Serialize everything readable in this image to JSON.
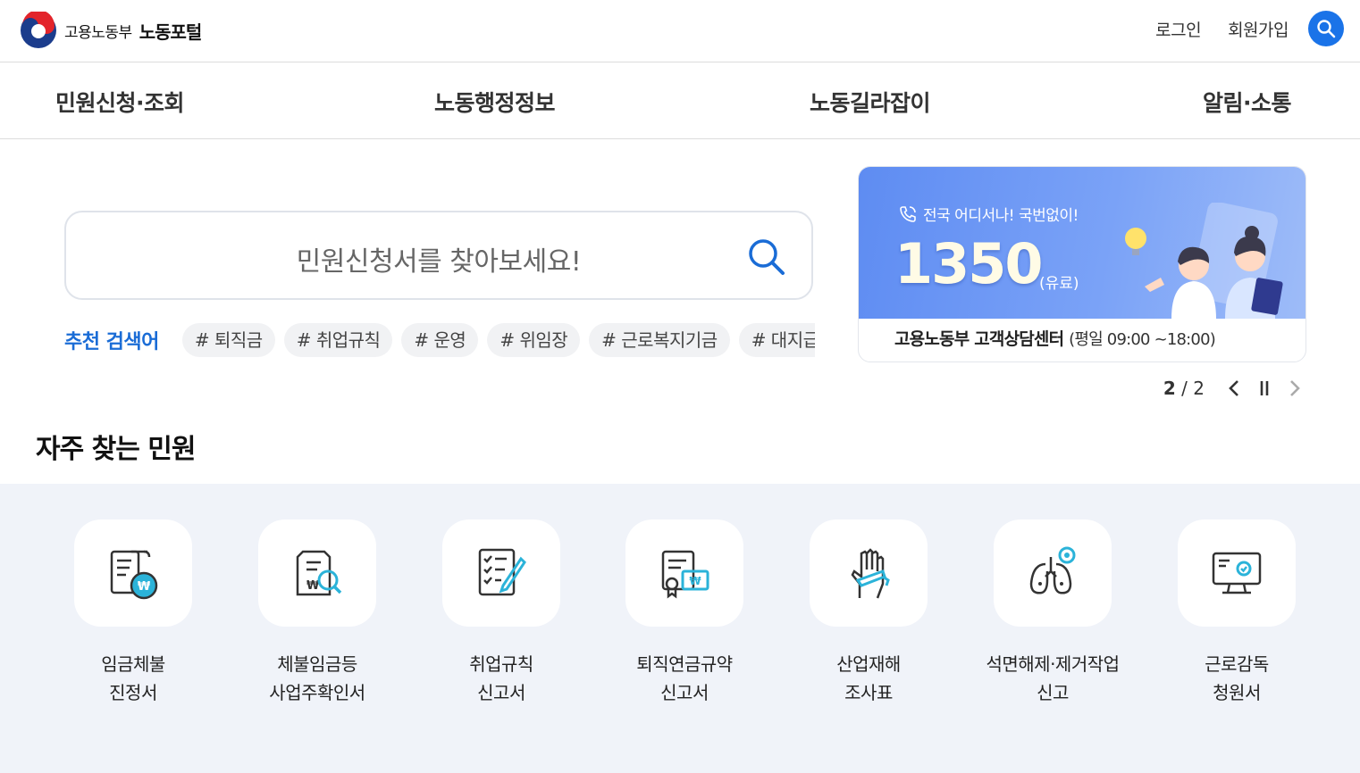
{
  "header": {
    "ministry": "고용노동부",
    "portal": "노동포털",
    "login": "로그인",
    "join": "회원가입"
  },
  "gnb": [
    "민원신청·조회",
    "노동행정정보",
    "노동길라잡이",
    "알림·소통"
  ],
  "search": {
    "placeholder": "민원신청서를 찾아보세요!"
  },
  "recommend": {
    "title": "추천 검색어",
    "tags": [
      "# 퇴직금",
      "# 취업규칙",
      "# 운영",
      "# 위임장",
      "# 근로복지기금",
      "# 대지급금"
    ]
  },
  "banner": {
    "subtitle": "전국 어디서나! 국번없이!",
    "number": "1350",
    "paid": "(유료)",
    "caption": "고용노동부 고객상담센터",
    "hours": "(평일 09:00 ~18:00)"
  },
  "slider": {
    "current": "2",
    "total": "2"
  },
  "frequent": {
    "title": "자주 찾는 민원",
    "items": [
      {
        "line1": "임금체불",
        "line2": "진정서"
      },
      {
        "line1": "체불임금등",
        "line2": "사업주확인서"
      },
      {
        "line1": "취업규칙",
        "line2": "신고서"
      },
      {
        "line1": "퇴직연금규약",
        "line2": "신고서"
      },
      {
        "line1": "산업재해",
        "line2": "조사표"
      },
      {
        "line1": "석면해제·제거작업",
        "line2": "신고"
      },
      {
        "line1": "근로감독",
        "line2": "청원서"
      }
    ]
  },
  "colors": {
    "accent": "#1a73e8",
    "recommend_title": "#1a6cd6",
    "frequent_bg": "#f0f3f9",
    "icon_teal": "#2bb3d9"
  }
}
